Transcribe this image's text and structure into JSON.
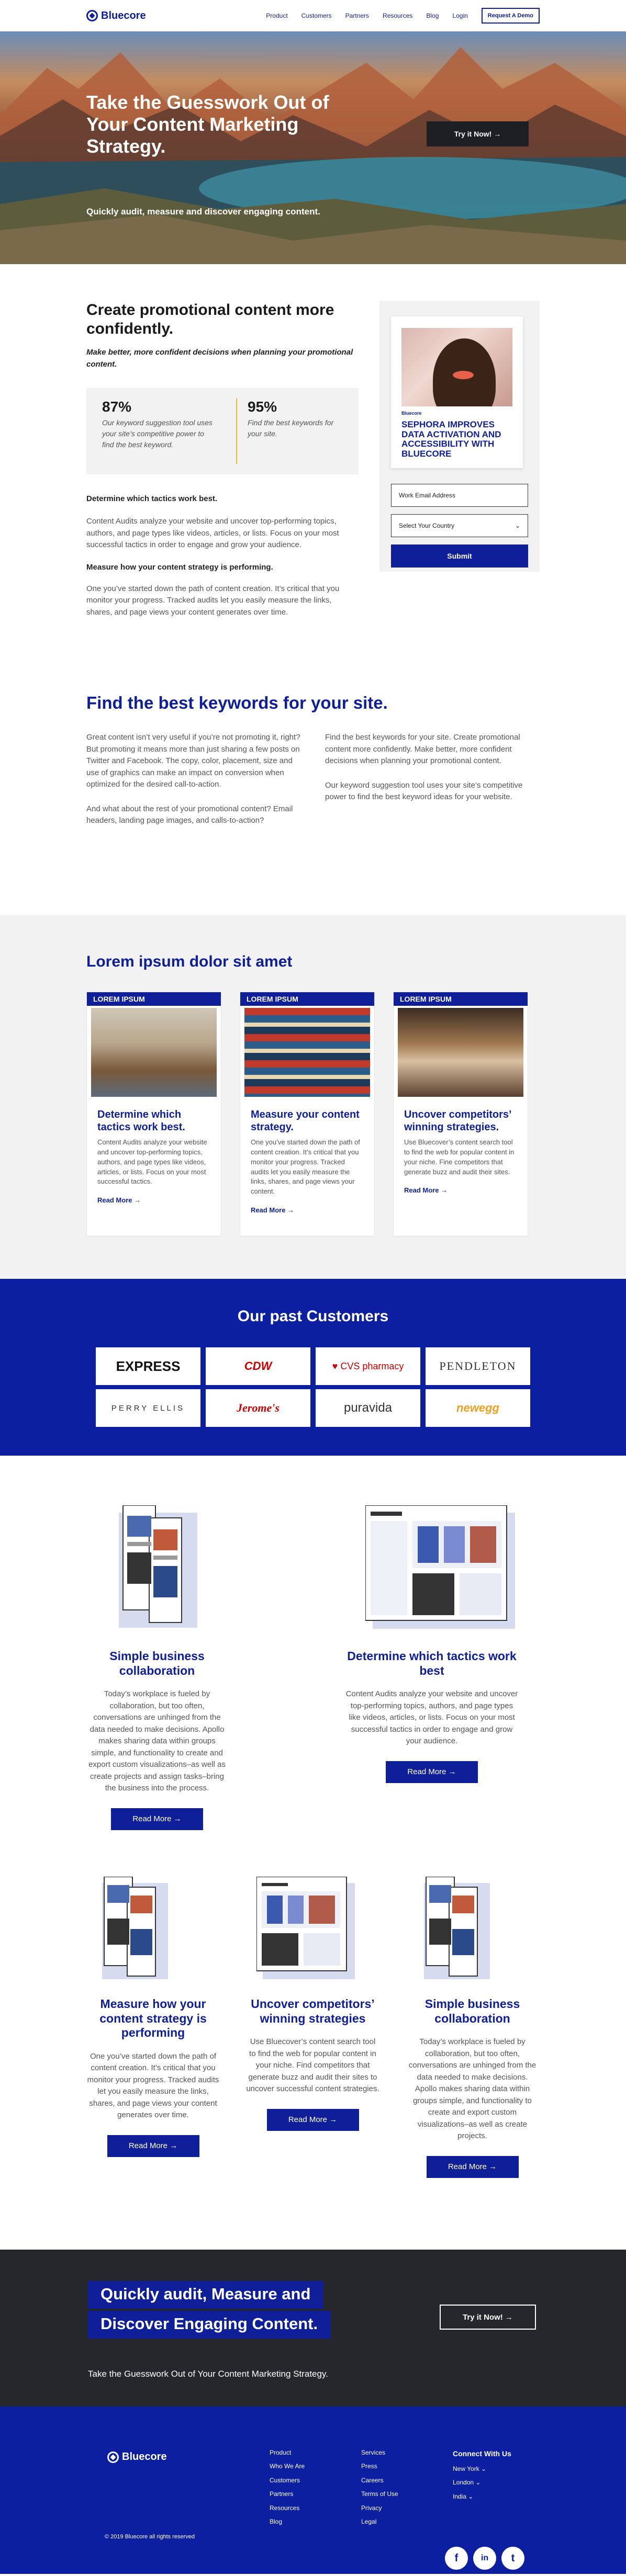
{
  "nav": {
    "logo": "Bluecore",
    "links": [
      "Product",
      "Customers",
      "Partners",
      "Resources",
      "Blog",
      "Login"
    ],
    "cta": "Request A Demo"
  },
  "hero": {
    "title": "Take the Guesswork Out of Your Content Marketing Strategy.",
    "subtitle": "Quickly audit, measure and discover engaging content.",
    "button": "Try it Now! →"
  },
  "intro": {
    "title": "Create promotional content more confidently.",
    "lede": "Make better, more confident decisions when planning your promotional content.",
    "stats": [
      {
        "value": "87%",
        "text": "Our keyword suggestion tool uses your site’s competitive power to find the best keyword."
      },
      {
        "value": "95%",
        "text": "Find the best keywords for your site."
      }
    ],
    "subhead1": "Determine which tactics work best.",
    "para1": "Content Audits analyze your website and uncover top-performing topics, authors, and page types like videos, articles, or lists. Focus on your most successful tactics in order to engage and grow your audience.",
    "subhead2": "Measure how your content strategy is performing.",
    "para2": "One you’ve started down the path of content creation. It’s critical that you monitor your progress. Tracked audits let you easily measure the links, shares, and page views your content generates over time."
  },
  "form": {
    "ebook_brand": "Bluecore",
    "ebook_title": "SEPHORA IMPROVES DATA ACTIVATION AND ACCESSIBILITY WITH BLUECORE",
    "email_placeholder": "Work Email Address",
    "country_placeholder": "Select Your Country",
    "submit": "Submit"
  },
  "keywords": {
    "title": "Find the best keywords for your site.",
    "left": [
      "Great content isn’t very useful if you’re not promoting it, right? But promoting it means more than just sharing a few posts on Twitter and Facebook. The copy, color, placement, size and use of graphics can make an impact on conversion when optimized for the desired call-to-action.",
      "And what about the rest of your promotional content? Email headers, landing page images, and calls-to-action?"
    ],
    "right": [
      "Find the best keywords for your site. Create promotional content more confidently. Make better, more confident decisions when planning your promotional content.",
      "Our keyword suggestion tool uses your site’s competitive power to find the best keyword ideas for your website."
    ]
  },
  "lorem": {
    "title": "Lorem ipsum dolor sit amet",
    "cards": [
      {
        "tag": "LOREM IPSUM",
        "title": "Determine which tactics work best.",
        "text": "Content Audits analyze your website and uncover top-performing topics, authors, and page types like videos, articles, or lists. Focus on your most successful tactics.",
        "more": "Read More →"
      },
      {
        "tag": "LOREM IPSUM",
        "title": "Measure your content strategy.",
        "text": "One you’ve started down the path of content creation. It’s critical that you monitor your progress. Tracked audits let you easily measure the links, shares, and page views your content.",
        "more": "Read More →"
      },
      {
        "tag": "LOREM IPSUM",
        "title": "Uncover competitors’ winning strategies.",
        "text": "Use Bluecover’s content search tool to find the web for popular content in your niche. Fine competitors that generate buzz and audit their sites.",
        "more": "Read More →"
      }
    ]
  },
  "customers": {
    "title": "Our past Customers",
    "logos": [
      "EXPRESS",
      "CDW",
      "CVS pharmacy",
      "PENDLETON",
      "PERRY ELLIS",
      "Jerome's",
      "puravida",
      "newegg"
    ]
  },
  "features": [
    {
      "title": "Simple business collaboration",
      "text": "Today’s workplace is fueled by collaboration, but too often, conversations are unhinged from the data needed to make decisions. Apollo makes sharing data within groups simple, and functionality to create and export custom visualizations–as well as create projects and assign tasks–bring the business into the process.",
      "button": "Read More →"
    },
    {
      "title": "Determine which tactics work best",
      "text": "Content Audits analyze your website and uncover top-performing topics, authors, and page types like videos, articles, or lists. Focus on your most successful tactics in order to engage and grow your audience.",
      "button": "Read More →"
    },
    {
      "title": "Measure how your content strategy is performing",
      "text": "One you’ve started down the path of content creation. It’s critical that you monitor your progress. Tracked audits let you easily measure the links, shares, and page views your content generates over time.",
      "button": "Read More →"
    },
    {
      "title": "Uncover competitors’ winning strategies",
      "text": "Use Bluecover’s content search tool to find the web for popular content in your niche. Find competitors that generate buzz and audit their sites to uncover successful content strategies.",
      "button": "Read More →"
    },
    {
      "title": "Simple business collaboration",
      "text": "Today’s workplace is fueled by collaboration, but too often, conversations are unhinged from the data needed to make decisions. Apollo makes sharing data within groups simple, and functionality to create and export custom visualizations–as well as create projects.",
      "button": "Read More →"
    }
  ],
  "cta": {
    "line1": "Quickly audit, Measure and",
    "line2": "Discover Engaging Content.",
    "sub": "Take the Guesswork Out of Your Content Marketing Strategy.",
    "button": "Try it Now! →"
  },
  "footer": {
    "logo": "Bluecore",
    "col1": [
      "Product",
      "Who We Are",
      "Customers",
      "Partners",
      "Resources",
      "Blog"
    ],
    "col2": [
      "Services",
      "Press",
      "Careers",
      "Terms of Use",
      "Privacy",
      "Legal"
    ],
    "connect_title": "Connect With Us",
    "locations": [
      "New York",
      "London",
      "India"
    ],
    "copyright": "© 2019 Bluecore all rights reserved",
    "socials": [
      "f",
      "in",
      "t"
    ]
  },
  "colors": {
    "brand": "#0f1f9a",
    "dark": "#25272d",
    "accent": "#e8c020"
  }
}
